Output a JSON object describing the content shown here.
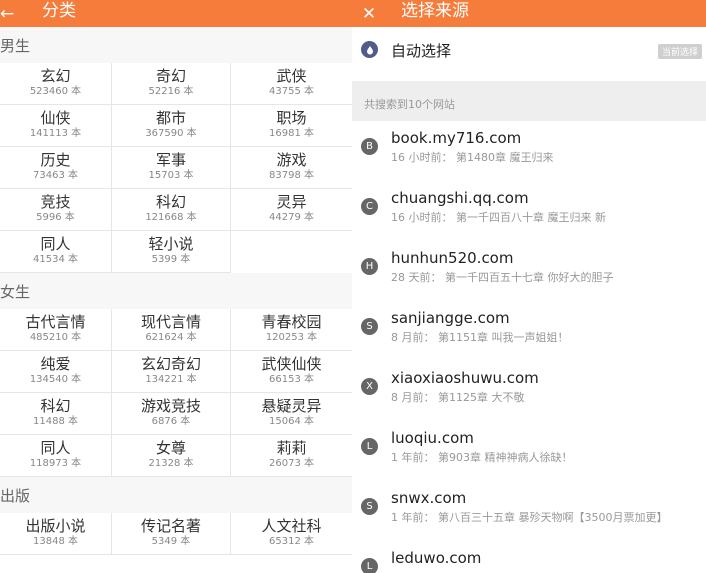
{
  "left": {
    "back_icon": "←",
    "title": "分类",
    "sections": [
      {
        "label": "男生",
        "items": [
          {
            "name": "玄幻",
            "count": "523460 本"
          },
          {
            "name": "奇幻",
            "count": "52216 本"
          },
          {
            "name": "武侠",
            "count": "43755 本"
          },
          {
            "name": "仙侠",
            "count": "141113 本"
          },
          {
            "name": "都市",
            "count": "367590 本"
          },
          {
            "name": "职场",
            "count": "16981 本"
          },
          {
            "name": "历史",
            "count": "73463 本"
          },
          {
            "name": "军事",
            "count": "15703 本"
          },
          {
            "name": "游戏",
            "count": "83798 本"
          },
          {
            "name": "竞技",
            "count": "5996 本"
          },
          {
            "name": "科幻",
            "count": "121668 本"
          },
          {
            "name": "灵异",
            "count": "44279 本"
          },
          {
            "name": "同人",
            "count": "41534 本"
          },
          {
            "name": "轻小说",
            "count": "5399 本"
          }
        ]
      },
      {
        "label": "女生",
        "items": [
          {
            "name": "古代言情",
            "count": "485210 本"
          },
          {
            "name": "现代言情",
            "count": "621624 本"
          },
          {
            "name": "青春校园",
            "count": "120253 本"
          },
          {
            "name": "纯爱",
            "count": "134540 本"
          },
          {
            "name": "玄幻奇幻",
            "count": "134221 本"
          },
          {
            "name": "武侠仙侠",
            "count": "66153 本"
          },
          {
            "name": "科幻",
            "count": "11488 本"
          },
          {
            "name": "游戏竞技",
            "count": "6876 本"
          },
          {
            "name": "悬疑灵异",
            "count": "15064 本"
          },
          {
            "name": "同人",
            "count": "118973 本"
          },
          {
            "name": "女尊",
            "count": "21328 本"
          },
          {
            "name": "莉莉",
            "count": "26073 本"
          }
        ]
      },
      {
        "label": "出版",
        "items": [
          {
            "name": "出版小说",
            "count": "13848 本"
          },
          {
            "name": "传记名著",
            "count": "5349 本"
          },
          {
            "name": "人文社科",
            "count": "65312 本"
          }
        ]
      }
    ]
  },
  "right": {
    "close_icon": "✕",
    "title": "选择来源",
    "auto_select_label": "自动选择",
    "current_badge": "当前选择",
    "search_info": "共搜索到10个网站",
    "sources": [
      {
        "letter": "B",
        "host": "book.my716.com",
        "latest": "16 小时前： 第1480章 魔王归来"
      },
      {
        "letter": "C",
        "host": "chuangshi.qq.com",
        "latest": "16 小时前： 第一千四百八十章 魔王归来 新"
      },
      {
        "letter": "H",
        "host": "hunhun520.com",
        "latest": "28 天前： 第一千四百五十七章 你好大的胆子"
      },
      {
        "letter": "S",
        "host": "sanjiangge.com",
        "latest": "8 月前： 第1151章 叫我一声姐姐！"
      },
      {
        "letter": "X",
        "host": "xiaoxiaoshuwu.com",
        "latest": "8 月前： 第1125章 大不敬"
      },
      {
        "letter": "L",
        "host": "luoqiu.com",
        "latest": "1 年前： 第903章 精神神病人徐缺！"
      },
      {
        "letter": "S",
        "host": "snwx.com",
        "latest": "1 年前： 第八百三十五章 暴殄天物啊【3500月票加更】"
      },
      {
        "letter": "L",
        "host": "leduwo.com",
        "latest": ""
      }
    ]
  }
}
